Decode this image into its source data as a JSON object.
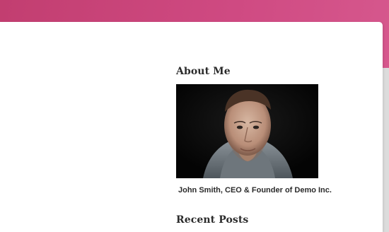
{
  "sidebar": {
    "about_widget": {
      "title": "About Me",
      "image_caption": "John Smith, CEO & Founder of Demo Inc."
    },
    "recent_posts_widget": {
      "title": "Recent Posts"
    }
  },
  "colors": {
    "header_gradient_start": "#c23e70",
    "header_gradient_end": "#d75a8f",
    "card_background": "#ffffff",
    "heading_text": "#2b2b2b"
  },
  "icons": {
    "profile_photo": "portrait-photo"
  }
}
